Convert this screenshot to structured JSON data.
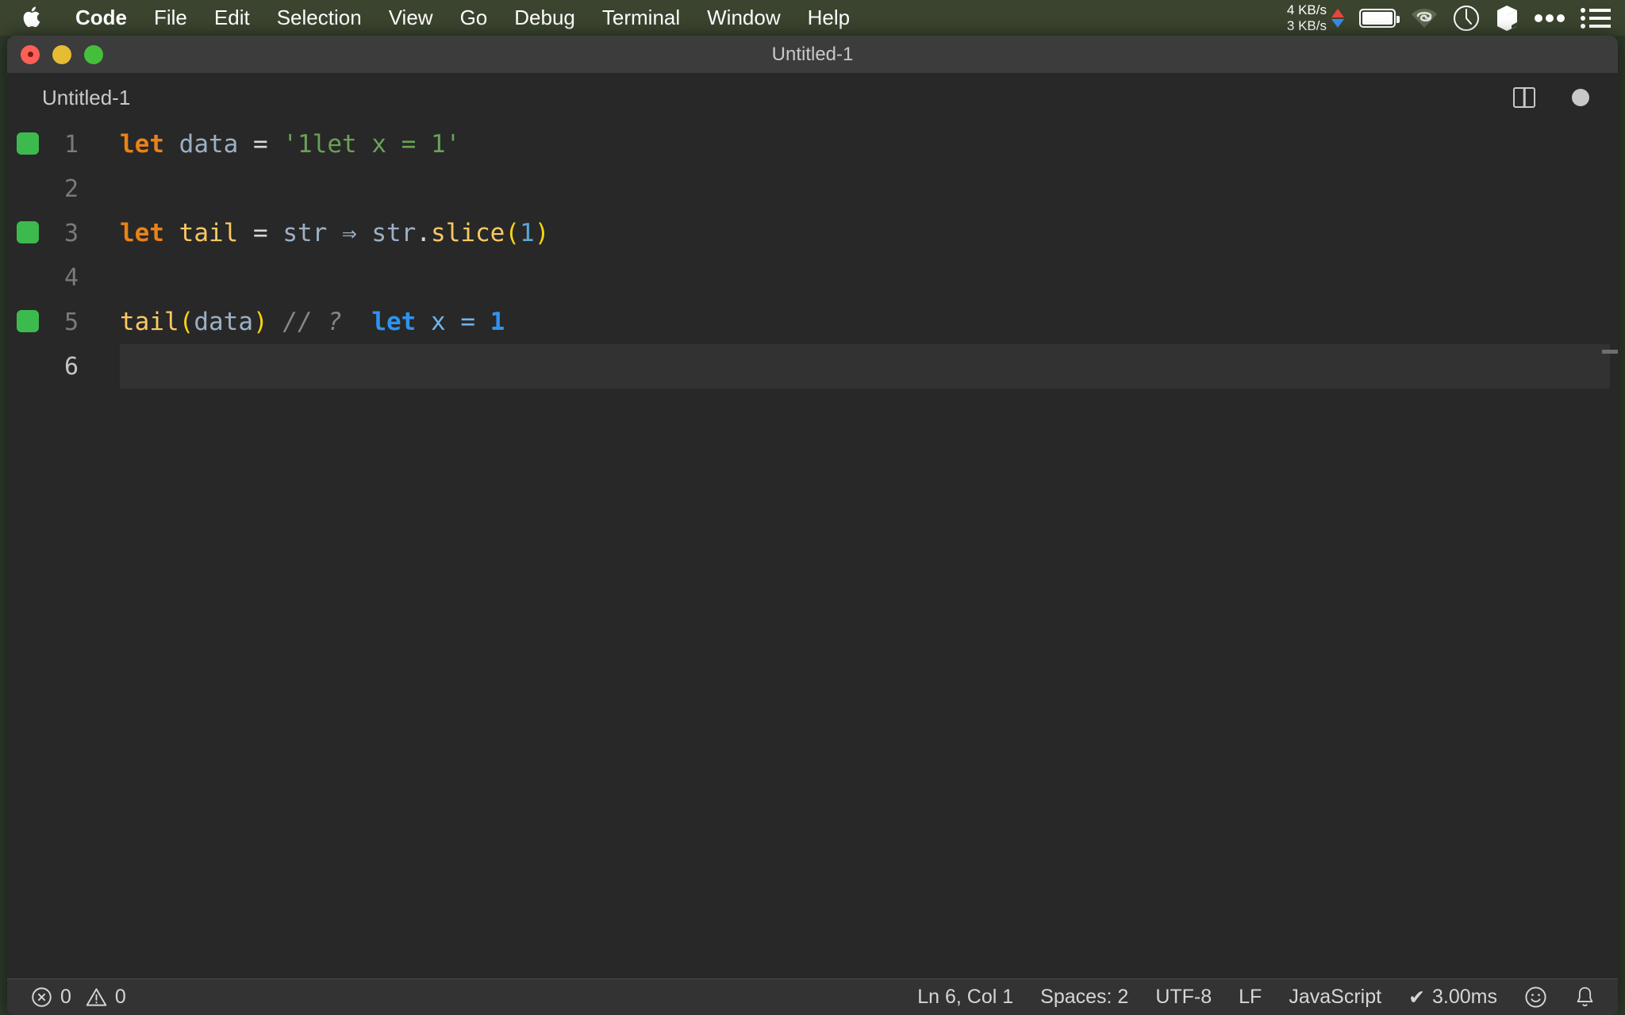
{
  "menubar": {
    "apple_icon": "apple-logo-icon",
    "items": [
      {
        "label": "Code",
        "bold": true
      },
      {
        "label": "File"
      },
      {
        "label": "Edit"
      },
      {
        "label": "Selection"
      },
      {
        "label": "View"
      },
      {
        "label": "Go"
      },
      {
        "label": "Debug"
      },
      {
        "label": "Terminal"
      },
      {
        "label": "Window"
      },
      {
        "label": "Help"
      }
    ],
    "status": {
      "upload_speed": "4 KB/s",
      "download_speed": "3 KB/s",
      "upload_arrow_color": "#e8453c",
      "download_arrow_color": "#3b8eea",
      "icons": [
        "battery-icon",
        "wifi-icon",
        "clock-icon",
        "cube-icon",
        "ellipsis-icon",
        "list-menu-icon"
      ]
    }
  },
  "window": {
    "title": "Untitled-1",
    "traffic_lights": [
      "close-button",
      "minimize-button",
      "maximize-button"
    ]
  },
  "tabbar": {
    "active_tab": "Untitled-1",
    "actions": [
      "split-editor-icon",
      "unsaved-dot-icon"
    ]
  },
  "editor": {
    "language": "JavaScript",
    "lines": [
      {
        "number": "1",
        "coverage": true,
        "active": false,
        "tokens": [
          {
            "t": "let",
            "c": "kw"
          },
          {
            "t": " ",
            "c": "op"
          },
          {
            "t": "data",
            "c": "var"
          },
          {
            "t": " ",
            "c": "op"
          },
          {
            "t": "=",
            "c": "op"
          },
          {
            "t": " ",
            "c": "op"
          },
          {
            "t": "'1let x = 1'",
            "c": "str"
          }
        ]
      },
      {
        "number": "2",
        "coverage": false,
        "active": false,
        "tokens": []
      },
      {
        "number": "3",
        "coverage": true,
        "active": false,
        "tokens": [
          {
            "t": "let",
            "c": "kw"
          },
          {
            "t": " ",
            "c": "op"
          },
          {
            "t": "tail",
            "c": "fn"
          },
          {
            "t": " ",
            "c": "op"
          },
          {
            "t": "=",
            "c": "op"
          },
          {
            "t": " ",
            "c": "op"
          },
          {
            "t": "str",
            "c": "var"
          },
          {
            "t": " ",
            "c": "op"
          },
          {
            "t": "⇒",
            "c": "var"
          },
          {
            "t": " ",
            "c": "op"
          },
          {
            "t": "str",
            "c": "var"
          },
          {
            "t": ".",
            "c": "op"
          },
          {
            "t": "slice",
            "c": "fn"
          },
          {
            "t": "(",
            "c": "paren"
          },
          {
            "t": "1",
            "c": "num"
          },
          {
            "t": ")",
            "c": "paren"
          }
        ]
      },
      {
        "number": "4",
        "coverage": false,
        "active": false,
        "tokens": []
      },
      {
        "number": "5",
        "coverage": true,
        "active": false,
        "tokens": [
          {
            "t": "tail",
            "c": "fn"
          },
          {
            "t": "(",
            "c": "paren"
          },
          {
            "t": "data",
            "c": "var"
          },
          {
            "t": ")",
            "c": "paren"
          },
          {
            "t": " ",
            "c": "op"
          },
          {
            "t": "// ?",
            "c": "comment"
          },
          {
            "t": "  ",
            "c": "op"
          },
          {
            "t": "let",
            "c": "quokka"
          },
          {
            "t": " ",
            "c": "op"
          },
          {
            "t": "x",
            "c": "quokka-v"
          },
          {
            "t": " ",
            "c": "op"
          },
          {
            "t": "=",
            "c": "quokka-v"
          },
          {
            "t": " ",
            "c": "op"
          },
          {
            "t": "1",
            "c": "quokka"
          }
        ]
      },
      {
        "number": "6",
        "coverage": false,
        "active": true,
        "tokens": []
      }
    ]
  },
  "statusbar": {
    "errors_icon": "error-circle-icon",
    "errors": "0",
    "warnings_icon": "warning-triangle-icon",
    "warnings": "0",
    "cursor_position": "Ln 6, Col 1",
    "indentation": "Spaces: 2",
    "encoding": "UTF-8",
    "eol": "LF",
    "language_mode": "JavaScript",
    "quokka_check": "✔",
    "quokka_time": "3.00ms",
    "feedback_icon": "smiley-icon",
    "notifications_icon": "bell-icon"
  },
  "colors": {
    "menubar_bg": "#3b442f",
    "titlebar_bg": "#3c3c3c",
    "editor_bg": "#282828",
    "statusbar_bg": "#333333",
    "coverage_green": "#3dba4e",
    "keyword_orange": "#e8821a",
    "function_yellow": "#fac863",
    "string_green": "#6aa158",
    "quokka_blue": "#2f93f0"
  }
}
